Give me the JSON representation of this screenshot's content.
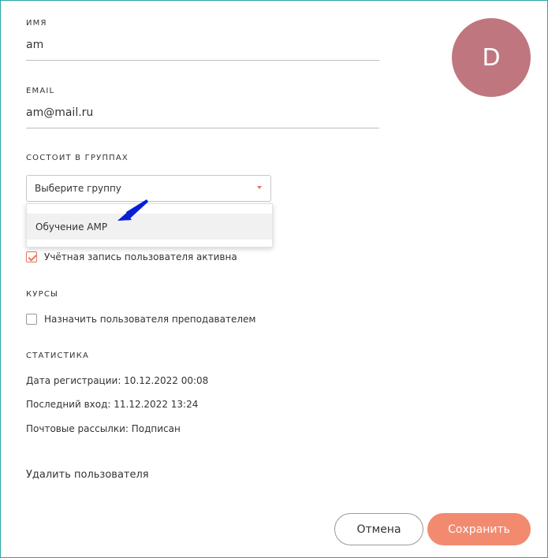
{
  "profile": {
    "name_label": "ИМЯ",
    "name_value": "am",
    "email_label": "EMAIL",
    "email_value": "am@mail.ru",
    "avatar_letter": "D",
    "avatar_color": "#c0767e"
  },
  "groups": {
    "label": "СОСТОИТ В ГРУППАХ",
    "select_placeholder": "Выберите группу",
    "options": [
      "Обучение AMP"
    ]
  },
  "account": {
    "active_label": "Учётная запись пользователя активна",
    "active_checked": true
  },
  "courses": {
    "label": "КУРСЫ",
    "teacher_label": "Назначить пользователя преподавателем",
    "teacher_checked": false
  },
  "statistics": {
    "label": "СТАТИСТИКА",
    "registration": "Дата регистрации: 10.12.2022 00:08",
    "last_login": "Последний вход: 11.12.2022 13:24",
    "mailing": "Почтовые рассылки: Подписан"
  },
  "actions": {
    "delete_label": "Удалить пользователя",
    "cancel_label": "Отмена",
    "save_label": "Сохранить"
  },
  "colors": {
    "accent": "#f28a70",
    "frame_border": "#2aa6a6",
    "annotation_arrow": "#0a1ed6"
  }
}
